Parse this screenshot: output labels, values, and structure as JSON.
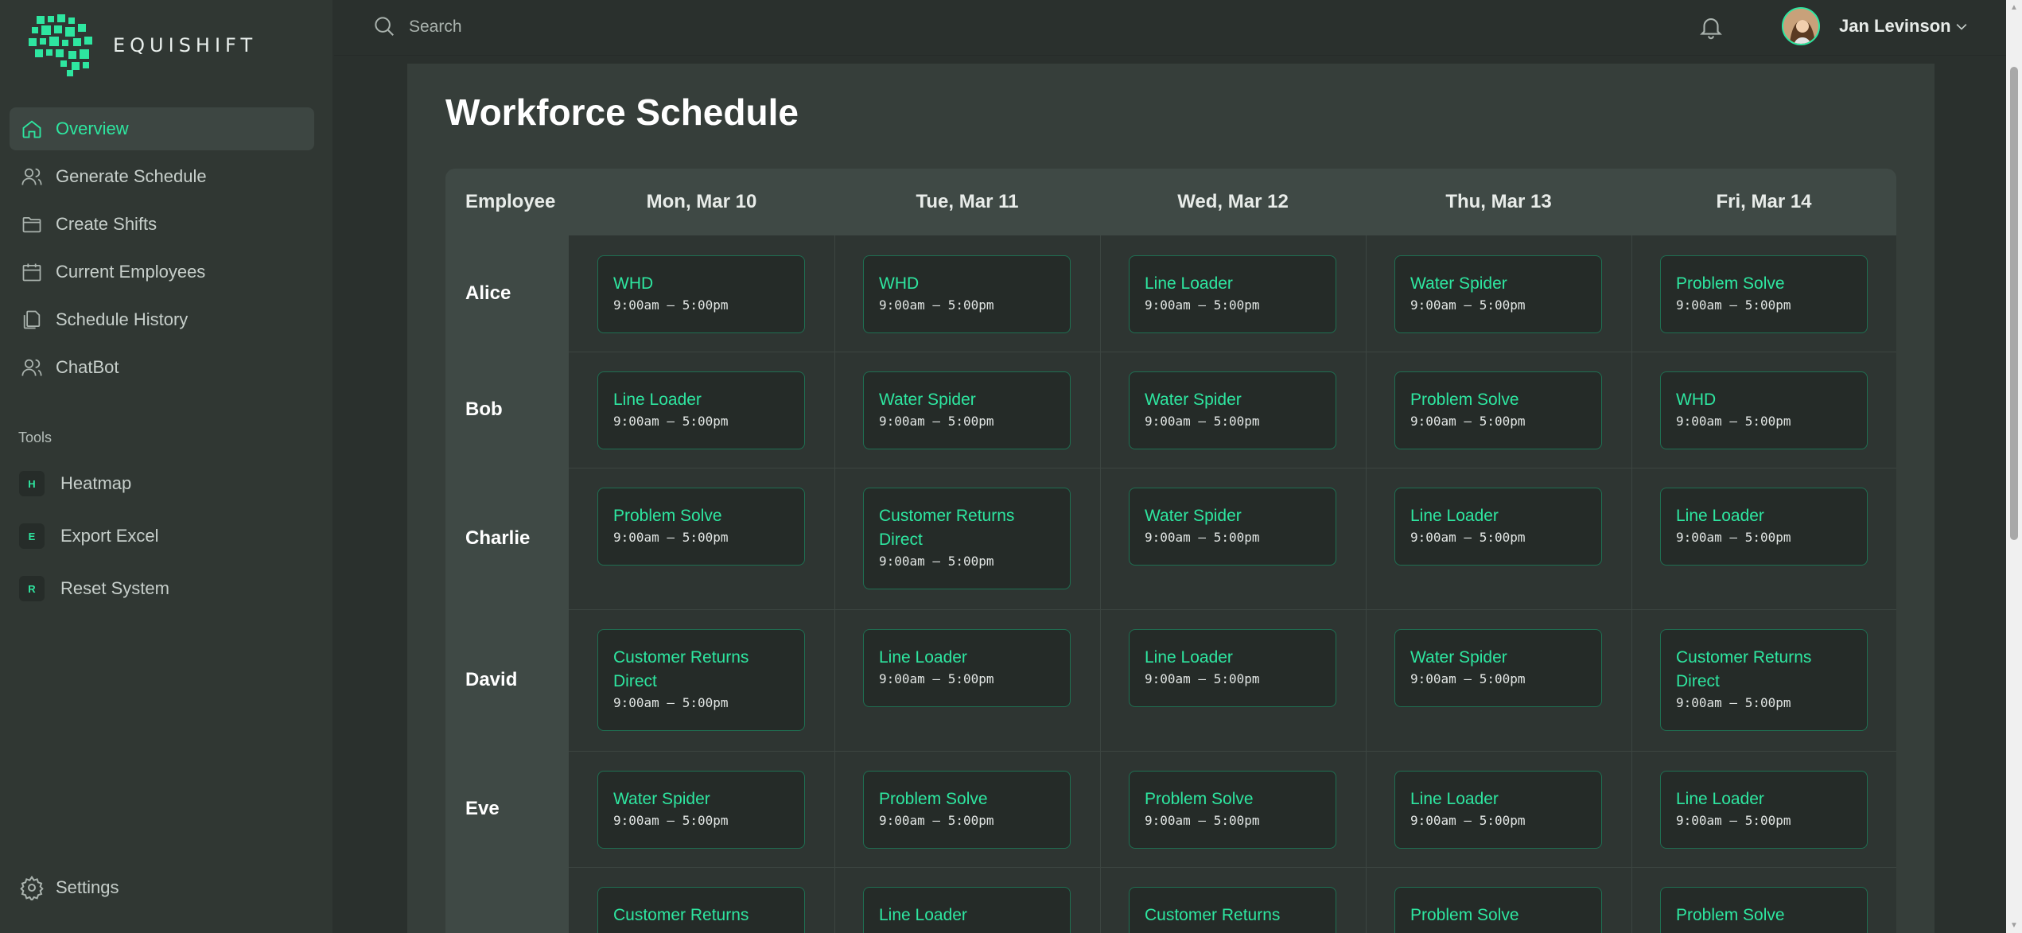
{
  "brand": {
    "name": "EQUISHIFT"
  },
  "nav": {
    "items": [
      {
        "label": "Overview",
        "icon": "home-icon",
        "active": true
      },
      {
        "label": "Generate Schedule",
        "icon": "users-icon"
      },
      {
        "label": "Create Shifts",
        "icon": "folder-icon"
      },
      {
        "label": "Current Employees",
        "icon": "calendar-icon"
      },
      {
        "label": "Schedule History",
        "icon": "documents-icon"
      },
      {
        "label": "ChatBot",
        "icon": "users-icon"
      }
    ]
  },
  "tools": {
    "title": "Tools",
    "items": [
      {
        "badge": "H",
        "label": "Heatmap"
      },
      {
        "badge": "E",
        "label": "Export Excel"
      },
      {
        "badge": "R",
        "label": "Reset System"
      }
    ]
  },
  "settings": {
    "label": "Settings"
  },
  "topbar": {
    "search_placeholder": "Search",
    "user_name": "Jan Levinson"
  },
  "colors": {
    "accent": "#2ee6a0",
    "panel": "#363e3a",
    "card": "#252b28"
  },
  "schedule": {
    "title": "Workforce Schedule",
    "employee_header": "Employee",
    "days": [
      "Mon, Mar 10",
      "Tue, Mar 11",
      "Wed, Mar 12",
      "Thu, Mar 13",
      "Fri, Mar 14"
    ],
    "rows": [
      {
        "name": "Alice",
        "shifts": [
          {
            "role": "WHD",
            "time": "9:00am – 5:00pm"
          },
          {
            "role": "WHD",
            "time": "9:00am – 5:00pm"
          },
          {
            "role": "Line Loader",
            "time": "9:00am – 5:00pm"
          },
          {
            "role": "Water Spider",
            "time": "9:00am – 5:00pm"
          },
          {
            "role": "Problem Solve",
            "time": "9:00am – 5:00pm"
          }
        ]
      },
      {
        "name": "Bob",
        "shifts": [
          {
            "role": "Line Loader",
            "time": "9:00am – 5:00pm"
          },
          {
            "role": "Water Spider",
            "time": "9:00am – 5:00pm"
          },
          {
            "role": "Water Spider",
            "time": "9:00am – 5:00pm"
          },
          {
            "role": "Problem Solve",
            "time": "9:00am – 5:00pm"
          },
          {
            "role": "WHD",
            "time": "9:00am – 5:00pm"
          }
        ]
      },
      {
        "name": "Charlie",
        "shifts": [
          {
            "role": "Problem Solve",
            "time": "9:00am – 5:00pm"
          },
          {
            "role": "Customer Returns Direct",
            "time": "9:00am – 5:00pm"
          },
          {
            "role": "Water Spider",
            "time": "9:00am – 5:00pm"
          },
          {
            "role": "Line Loader",
            "time": "9:00am – 5:00pm"
          },
          {
            "role": "Line Loader",
            "time": "9:00am – 5:00pm"
          }
        ]
      },
      {
        "name": "David",
        "shifts": [
          {
            "role": "Customer Returns Direct",
            "time": "9:00am – 5:00pm"
          },
          {
            "role": "Line Loader",
            "time": "9:00am – 5:00pm"
          },
          {
            "role": "Line Loader",
            "time": "9:00am – 5:00pm"
          },
          {
            "role": "Water Spider",
            "time": "9:00am – 5:00pm"
          },
          {
            "role": "Customer Returns Direct",
            "time": "9:00am – 5:00pm"
          }
        ]
      },
      {
        "name": "Eve",
        "shifts": [
          {
            "role": "Water Spider",
            "time": "9:00am – 5:00pm"
          },
          {
            "role": "Problem Solve",
            "time": "9:00am – 5:00pm"
          },
          {
            "role": "Problem Solve",
            "time": "9:00am – 5:00pm"
          },
          {
            "role": "Line Loader",
            "time": "9:00am – 5:00pm"
          },
          {
            "role": "Line Loader",
            "time": "9:00am – 5:00pm"
          }
        ]
      },
      {
        "name": "",
        "shifts": [
          {
            "role": "Customer Returns",
            "time": ""
          },
          {
            "role": "Line Loader",
            "time": ""
          },
          {
            "role": "Customer Returns",
            "time": ""
          },
          {
            "role": "Problem Solve",
            "time": ""
          },
          {
            "role": "Problem Solve",
            "time": ""
          }
        ]
      }
    ]
  }
}
